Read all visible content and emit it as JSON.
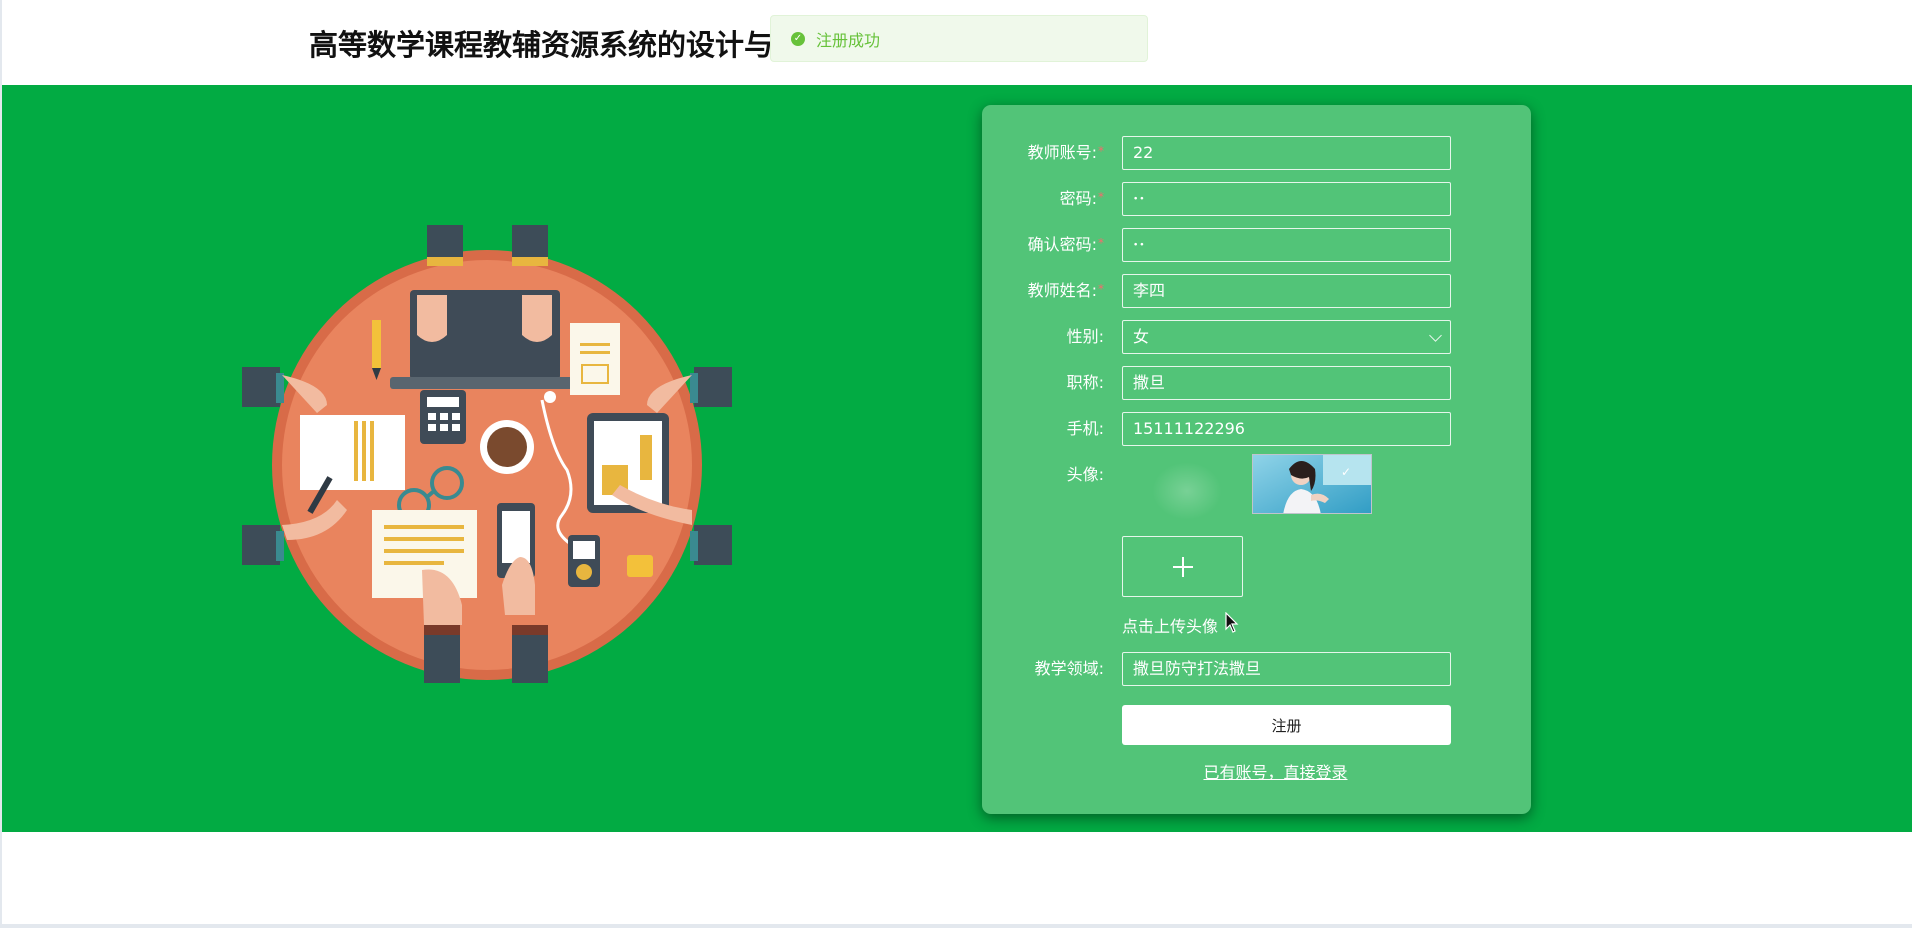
{
  "header": {
    "title": "高等数学课程教辅资源系统的设计与实现"
  },
  "toast": {
    "message": "注册成功",
    "icon": "check-circle-icon",
    "color": "#67c23a"
  },
  "theme": {
    "hero_background": "#02ab43",
    "card_background": "#52c478"
  },
  "form": {
    "fields": {
      "account": {
        "label": "教师账号:",
        "value": "22",
        "required": true
      },
      "password": {
        "label": "密码:",
        "value": "••",
        "required": true
      },
      "confirm": {
        "label": "确认密码:",
        "value": "••",
        "required": true
      },
      "name": {
        "label": "教师姓名:",
        "value": "李四",
        "required": true
      },
      "gender": {
        "label": "性别:",
        "value": "女"
      },
      "title": {
        "label": "职称:",
        "value": "撒旦"
      },
      "phone": {
        "label": "手机:",
        "value": "15111122296"
      },
      "avatar": {
        "label": "头像:",
        "upload_hint": "点击上传头像"
      },
      "field": {
        "label": "教学领域:",
        "value": "撒旦防守打法撒旦"
      }
    },
    "submit_label": "注册",
    "login_link": "已有账号，直接登录"
  }
}
